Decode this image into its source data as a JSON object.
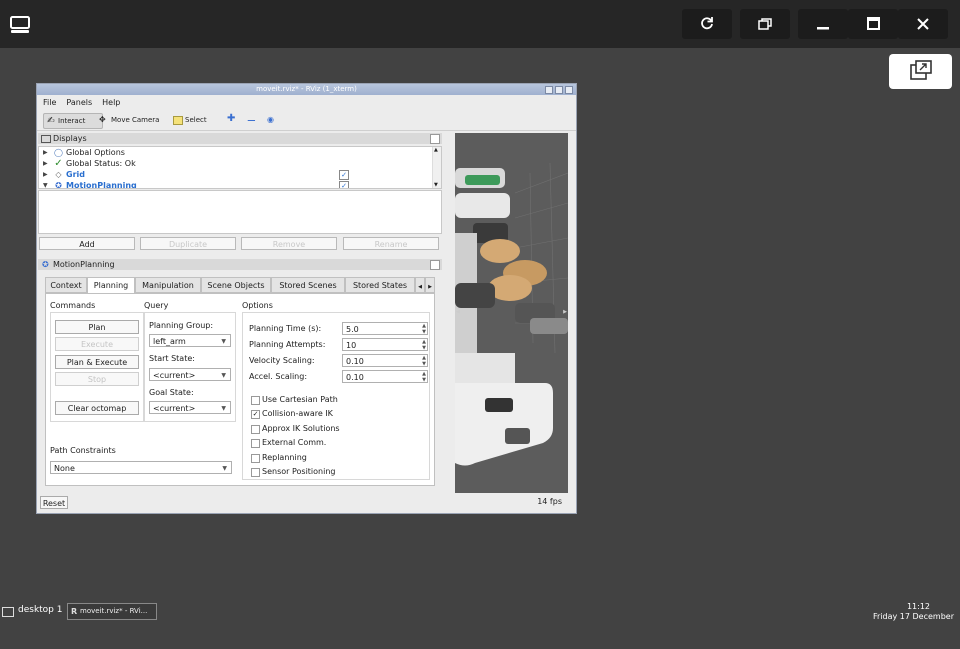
{
  "host": {
    "top_icons": [
      "desktop-icon",
      "refresh-icon",
      "restore-window-icon",
      "minimize-icon",
      "maximize-icon",
      "close-icon"
    ],
    "float_icon": "popout-icon"
  },
  "window": {
    "title": "moveit.rviz* - RViz (1_xterm)",
    "menu": [
      "File",
      "Panels",
      "Help"
    ],
    "toolbar": {
      "interact": "Interact",
      "move_camera": "Move Camera",
      "select": "Select"
    },
    "displays": {
      "header": "Displays",
      "items": [
        {
          "label": "Global Options",
          "icon": "globe-icon",
          "checked": null
        },
        {
          "label": "Global Status: Ok",
          "icon": "check-icon",
          "checked": null
        },
        {
          "label": "Grid",
          "icon": "grid-icon",
          "checked": true
        },
        {
          "label": "MotionPlanning",
          "icon": "arm-icon",
          "checked": true
        }
      ],
      "buttons": {
        "add": "Add",
        "duplicate": "Duplicate",
        "remove": "Remove",
        "rename": "Rename"
      }
    },
    "motion": {
      "header": "MotionPlanning",
      "tabs": [
        "Context",
        "Planning",
        "Manipulation",
        "Scene Objects",
        "Stored Scenes",
        "Stored States"
      ],
      "commands": {
        "title": "Commands",
        "plan": "Plan",
        "execute": "Execute",
        "plan_execute": "Plan & Execute",
        "stop": "Stop",
        "clear": "Clear octomap"
      },
      "query": {
        "title": "Query",
        "group_label": "Planning Group:",
        "group_value": "left_arm",
        "start_label": "Start State:",
        "start_value": "<current>",
        "goal_label": "Goal State:",
        "goal_value": "<current>"
      },
      "options": {
        "title": "Options",
        "planning_time_label": "Planning Time (s):",
        "planning_time": "5.0",
        "attempts_label": "Planning Attempts:",
        "attempts": "10",
        "velocity_label": "Velocity Scaling:",
        "velocity": "0.10",
        "accel_label": "Accel. Scaling:",
        "accel": "0.10",
        "checks": [
          {
            "label": "Use Cartesian Path",
            "checked": false
          },
          {
            "label": "Collision-aware IK",
            "checked": true
          },
          {
            "label": "Approx IK Solutions",
            "checked": false
          },
          {
            "label": "External Comm.",
            "checked": false
          },
          {
            "label": "Replanning",
            "checked": false
          },
          {
            "label": "Sensor Positioning",
            "checked": false
          }
        ]
      },
      "path_constraints": {
        "label": "Path Constraints",
        "value": "None"
      }
    },
    "reset": "Reset",
    "fps": "14 fps"
  },
  "taskbar": {
    "desktop": "desktop 1",
    "task": "moveit.rviz* - RVi...",
    "time": "11:12",
    "date": "Friday 17 December"
  }
}
